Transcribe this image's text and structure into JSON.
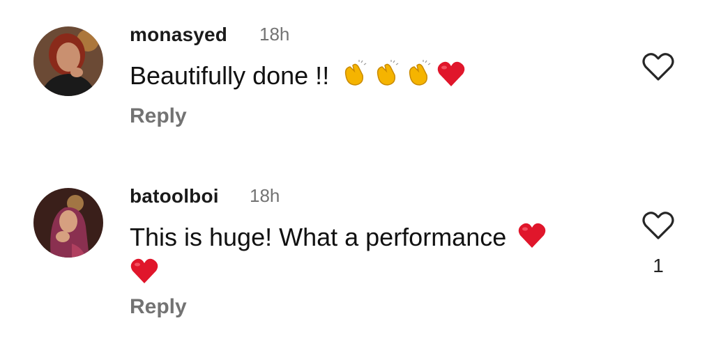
{
  "comments": [
    {
      "username": "monasyed",
      "time": "18h",
      "text": "Beautifully done !!",
      "emojis": [
        "clapping-hands",
        "clapping-hands",
        "clapping-hands",
        "red-heart"
      ],
      "reply_label": "Reply",
      "avatar_colors": {
        "bg": "#5a3a2a",
        "hair": "#8a2a1a",
        "skin": "#c99070",
        "clothes": "#1a1a1a"
      }
    },
    {
      "username": "batoolboi",
      "time": "18h",
      "text": "This is huge! What a performance",
      "emojis": [
        "red-heart",
        "red-heart"
      ],
      "like_count": "1",
      "reply_label": "Reply",
      "avatar_colors": {
        "bg": "#3a1f1a",
        "scarf": "#8a3050",
        "skin": "#d6a080",
        "light": "#e8b060"
      }
    }
  ],
  "colors": {
    "heart": "#e0162b",
    "clap": "#f5b400",
    "muted": "#737373"
  }
}
